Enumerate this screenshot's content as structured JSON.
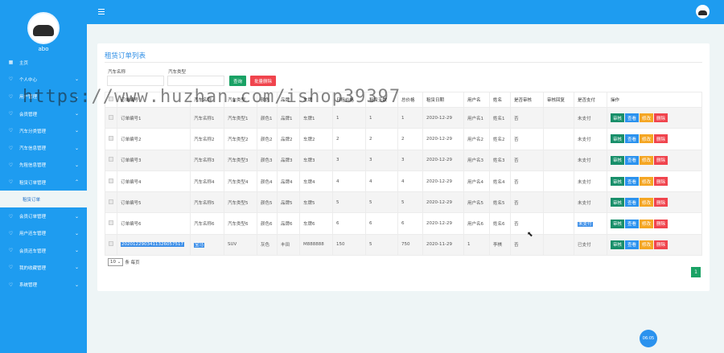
{
  "sidebar": {
    "username": "abo",
    "menu": [
      {
        "label": "主页",
        "icon": "grid-icon",
        "chev": ""
      },
      {
        "label": "个人中心",
        "icon": "user-icon",
        "chev": "⌄"
      },
      {
        "label": "用户管理",
        "icon": "user-icon",
        "chev": "⌄"
      },
      {
        "label": "会员管理",
        "icon": "user-icon",
        "chev": "⌄"
      },
      {
        "label": "汽车分类管理",
        "icon": "user-icon",
        "chev": "⌄"
      },
      {
        "label": "汽车信息管理",
        "icon": "user-icon",
        "chev": "⌄"
      },
      {
        "label": "先租信息管理",
        "icon": "user-icon",
        "chev": "⌄"
      },
      {
        "label": "租赁订单管理",
        "icon": "user-icon",
        "chev": "⌃"
      }
    ],
    "submenu_active": "租赁订单",
    "menu_after": [
      {
        "label": "会员订单管理",
        "icon": "user-icon",
        "chev": "⌄"
      },
      {
        "label": "用户还车管理",
        "icon": "user-icon",
        "chev": "⌄"
      },
      {
        "label": "会员还车管理",
        "icon": "user-icon",
        "chev": "⌄"
      },
      {
        "label": "我的收藏管理",
        "icon": "user-icon",
        "chev": "⌄"
      },
      {
        "label": "系统管理",
        "icon": "user-icon",
        "chev": "⌄"
      }
    ]
  },
  "card": {
    "title": "租赁订单列表",
    "filter_car_name_label": "汽车名称",
    "filter_car_type_label": "汽车类型",
    "search_button": "查询",
    "batch_delete_button": "批量删除"
  },
  "table": {
    "headers": [
      "订单编号",
      "汽车名称",
      "汽车类型",
      "颜色",
      "品牌",
      "车牌",
      "日租价格",
      "租赁天数",
      "总价格",
      "租赁日期",
      "用户名",
      "姓名",
      "是否审核",
      "审核回复",
      "是否支付",
      "操作"
    ],
    "rows": [
      [
        "订单编号1",
        "汽车名称1",
        "汽车类型1",
        "颜色1",
        "品牌1",
        "车牌1",
        "1",
        "1",
        "1",
        "2020-12-29",
        "用户名1",
        "姓名1",
        "否",
        "",
        "未支付"
      ],
      [
        "订单编号2",
        "汽车名称2",
        "汽车类型2",
        "颜色2",
        "品牌2",
        "车牌2",
        "2",
        "2",
        "2",
        "2020-12-29",
        "用户名2",
        "姓名2",
        "否",
        "",
        "未支付"
      ],
      [
        "订单编号3",
        "汽车名称3",
        "汽车类型3",
        "颜色3",
        "品牌3",
        "车牌3",
        "3",
        "3",
        "3",
        "2020-12-29",
        "用户名3",
        "姓名3",
        "否",
        "",
        "未支付"
      ],
      [
        "订单编号4",
        "汽车名称4",
        "汽车类型4",
        "颜色4",
        "品牌4",
        "车牌4",
        "4",
        "4",
        "4",
        "2020-12-29",
        "用户名4",
        "姓名4",
        "否",
        "",
        "未支付"
      ],
      [
        "订单编号5",
        "汽车名称5",
        "汽车类型5",
        "颜色5",
        "品牌5",
        "车牌5",
        "5",
        "5",
        "5",
        "2020-12-29",
        "用户名5",
        "姓名5",
        "否",
        "",
        "未支付"
      ],
      [
        "订单编号6",
        "汽车名称6",
        "汽车类型6",
        "颜色6",
        "品牌6",
        "车牌6",
        "6",
        "6",
        "6",
        "2020-12-29",
        "用户名6",
        "姓名6",
        "否",
        "",
        "未支付"
      ],
      [
        "2020122903411326057517",
        "宝马",
        "SUV",
        "灰色",
        "丰田",
        "M888888",
        "150",
        "5",
        "750",
        "2020-11-29",
        "1",
        "李棋",
        "否",
        "",
        "已支付"
      ]
    ],
    "ops": {
      "review": "审核",
      "view": "查看",
      "edit": "修改",
      "delete": "删除"
    }
  },
  "pager": {
    "page_size": "10",
    "per_page_label": "条 每页",
    "current_page": "1"
  },
  "float_button": "06:05",
  "watermark": "https://www.huzhan.com/ishop39397"
}
